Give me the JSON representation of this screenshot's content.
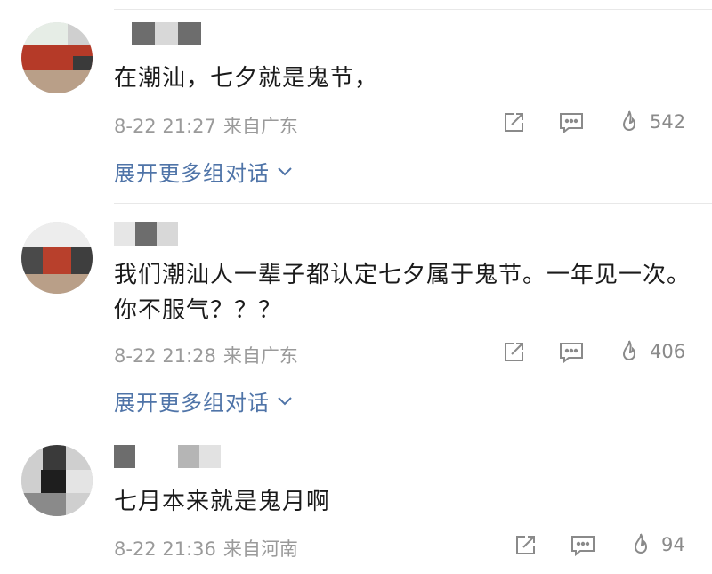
{
  "comments": [
    {
      "text": "在潮汕，七夕就是鬼节，",
      "date": "8-22 21:27",
      "location": "来自广东",
      "likes": "542",
      "expand_label": "展开更多组对话"
    },
    {
      "text": "我们潮汕人一辈子都认定七夕属于鬼节。一年见一次。你不服气？？？",
      "date": "8-22 21:28",
      "location": "来自广东",
      "likes": "406",
      "expand_label": "展开更多组对话"
    },
    {
      "text": "七月本来就是鬼月啊",
      "date": "8-22 21:36",
      "location": "来自河南",
      "likes": "94"
    }
  ],
  "icons": {
    "share": "share-icon",
    "comment": "comment-icon",
    "like": "flame-icon",
    "expand": "chevron-down-icon"
  },
  "colors": {
    "link": "#4f74a8",
    "meta": "#9a9a9a",
    "text": "#1a1a1a"
  }
}
